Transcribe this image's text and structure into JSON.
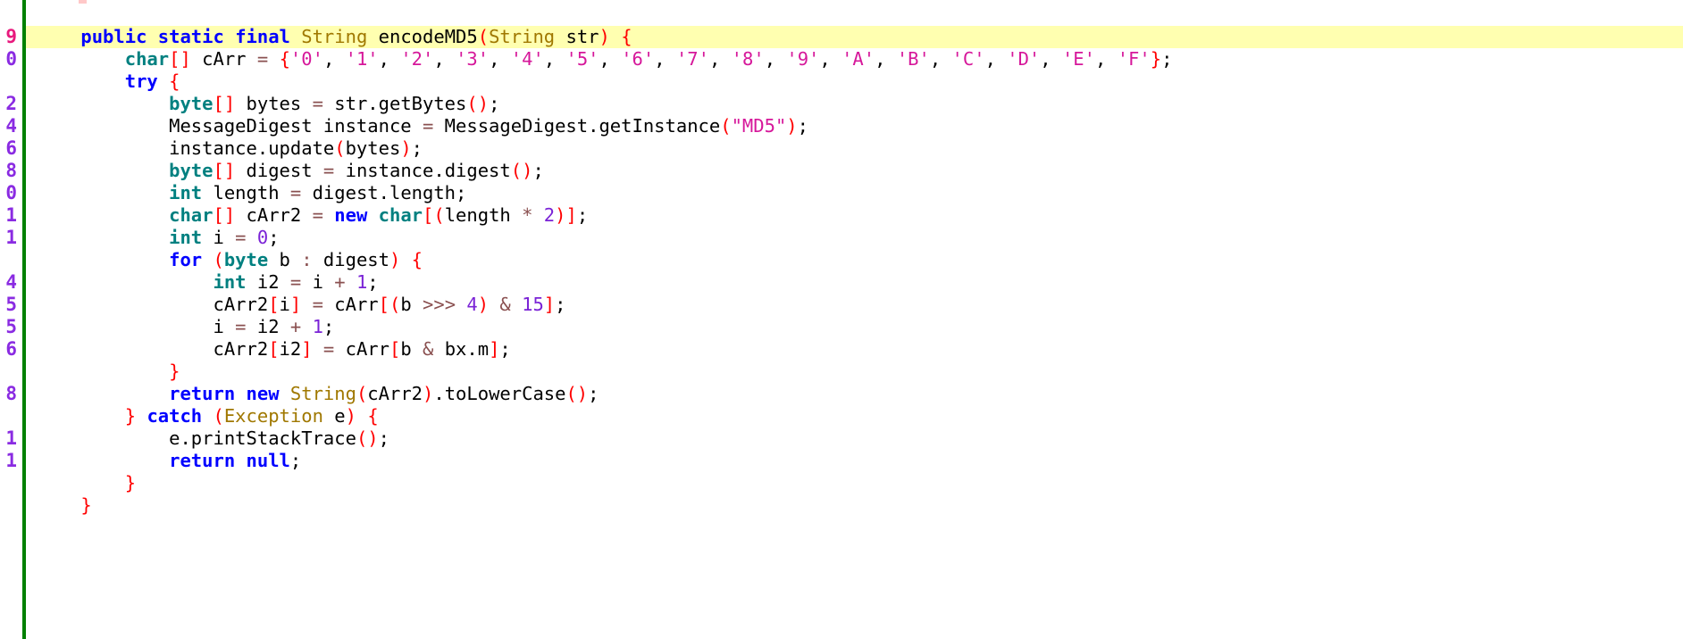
{
  "editor": {
    "language": "Java",
    "current_line_index": 0,
    "gutter_rule_color": "#008000",
    "highlight_color": "#ffffb0",
    "background_color": "#ffffff",
    "line_number_color": "#8a2be2",
    "current_line_number_color": "#e8197d",
    "font_size_px": 20.5,
    "line_height_px": 25
  },
  "palette": {
    "keyword": "#0000ff",
    "type": "#008080",
    "class": "#a07800",
    "punctuation": "#ff0000",
    "number": "#7a22d6",
    "string": "#d6179a",
    "operator": "#8a5050",
    "identifier": "#000000"
  },
  "lines": [
    {
      "number": "9",
      "current": true,
      "indent": 4,
      "tokens": [
        {
          "t": "public",
          "c": "kw"
        },
        {
          "t": " ",
          "c": "id"
        },
        {
          "t": "static",
          "c": "kw"
        },
        {
          "t": " ",
          "c": "id"
        },
        {
          "t": "final",
          "c": "kw"
        },
        {
          "t": " ",
          "c": "id"
        },
        {
          "t": "String",
          "c": "cls"
        },
        {
          "t": " ",
          "c": "id"
        },
        {
          "t": "encodeMD5",
          "c": "id"
        },
        {
          "t": "(",
          "c": "pn"
        },
        {
          "t": "String",
          "c": "cls"
        },
        {
          "t": " ",
          "c": "id"
        },
        {
          "t": "str",
          "c": "id"
        },
        {
          "t": ")",
          "c": "pn"
        },
        {
          "t": " ",
          "c": "id"
        },
        {
          "t": "{",
          "c": "pn"
        }
      ]
    },
    {
      "number": "0",
      "current": false,
      "indent": 8,
      "tokens": [
        {
          "t": "char",
          "c": "type"
        },
        {
          "t": "[]",
          "c": "pn"
        },
        {
          "t": " ",
          "c": "id"
        },
        {
          "t": "cArr",
          "c": "id"
        },
        {
          "t": " ",
          "c": "id"
        },
        {
          "t": "=",
          "c": "op"
        },
        {
          "t": " ",
          "c": "id"
        },
        {
          "t": "{",
          "c": "pn"
        },
        {
          "t": "'0'",
          "c": "str"
        },
        {
          "t": ", ",
          "c": "id"
        },
        {
          "t": "'1'",
          "c": "str"
        },
        {
          "t": ", ",
          "c": "id"
        },
        {
          "t": "'2'",
          "c": "str"
        },
        {
          "t": ", ",
          "c": "id"
        },
        {
          "t": "'3'",
          "c": "str"
        },
        {
          "t": ", ",
          "c": "id"
        },
        {
          "t": "'4'",
          "c": "str"
        },
        {
          "t": ", ",
          "c": "id"
        },
        {
          "t": "'5'",
          "c": "str"
        },
        {
          "t": ", ",
          "c": "id"
        },
        {
          "t": "'6'",
          "c": "str"
        },
        {
          "t": ", ",
          "c": "id"
        },
        {
          "t": "'7'",
          "c": "str"
        },
        {
          "t": ", ",
          "c": "id"
        },
        {
          "t": "'8'",
          "c": "str"
        },
        {
          "t": ", ",
          "c": "id"
        },
        {
          "t": "'9'",
          "c": "str"
        },
        {
          "t": ", ",
          "c": "id"
        },
        {
          "t": "'A'",
          "c": "str"
        },
        {
          "t": ", ",
          "c": "id"
        },
        {
          "t": "'B'",
          "c": "str"
        },
        {
          "t": ", ",
          "c": "id"
        },
        {
          "t": "'C'",
          "c": "str"
        },
        {
          "t": ", ",
          "c": "id"
        },
        {
          "t": "'D'",
          "c": "str"
        },
        {
          "t": ", ",
          "c": "id"
        },
        {
          "t": "'E'",
          "c": "str"
        },
        {
          "t": ", ",
          "c": "id"
        },
        {
          "t": "'F'",
          "c": "str"
        },
        {
          "t": "}",
          "c": "pn"
        },
        {
          "t": ";",
          "c": "id"
        }
      ]
    },
    {
      "number": "",
      "current": false,
      "indent": 8,
      "tokens": [
        {
          "t": "try",
          "c": "kw"
        },
        {
          "t": " ",
          "c": "id"
        },
        {
          "t": "{",
          "c": "pn"
        }
      ]
    },
    {
      "number": "2",
      "current": false,
      "indent": 12,
      "tokens": [
        {
          "t": "byte",
          "c": "type"
        },
        {
          "t": "[]",
          "c": "pn"
        },
        {
          "t": " ",
          "c": "id"
        },
        {
          "t": "bytes",
          "c": "id"
        },
        {
          "t": " ",
          "c": "id"
        },
        {
          "t": "=",
          "c": "op"
        },
        {
          "t": " ",
          "c": "id"
        },
        {
          "t": "str.getBytes",
          "c": "id"
        },
        {
          "t": "()",
          "c": "pn"
        },
        {
          "t": ";",
          "c": "id"
        }
      ]
    },
    {
      "number": "4",
      "current": false,
      "indent": 12,
      "tokens": [
        {
          "t": "MessageDigest instance",
          "c": "id"
        },
        {
          "t": " ",
          "c": "id"
        },
        {
          "t": "=",
          "c": "op"
        },
        {
          "t": " ",
          "c": "id"
        },
        {
          "t": "MessageDigest.getInstance",
          "c": "id"
        },
        {
          "t": "(",
          "c": "pn"
        },
        {
          "t": "\"MD5\"",
          "c": "str"
        },
        {
          "t": ")",
          "c": "pn"
        },
        {
          "t": ";",
          "c": "id"
        }
      ]
    },
    {
      "number": "6",
      "current": false,
      "indent": 12,
      "tokens": [
        {
          "t": "instance.update",
          "c": "id"
        },
        {
          "t": "(",
          "c": "pn"
        },
        {
          "t": "bytes",
          "c": "id"
        },
        {
          "t": ")",
          "c": "pn"
        },
        {
          "t": ";",
          "c": "id"
        }
      ]
    },
    {
      "number": "8",
      "current": false,
      "indent": 12,
      "tokens": [
        {
          "t": "byte",
          "c": "type"
        },
        {
          "t": "[]",
          "c": "pn"
        },
        {
          "t": " ",
          "c": "id"
        },
        {
          "t": "digest",
          "c": "id"
        },
        {
          "t": " ",
          "c": "id"
        },
        {
          "t": "=",
          "c": "op"
        },
        {
          "t": " ",
          "c": "id"
        },
        {
          "t": "instance.digest",
          "c": "id"
        },
        {
          "t": "()",
          "c": "pn"
        },
        {
          "t": ";",
          "c": "id"
        }
      ]
    },
    {
      "number": "0",
      "current": false,
      "indent": 12,
      "tokens": [
        {
          "t": "int",
          "c": "type"
        },
        {
          "t": " ",
          "c": "id"
        },
        {
          "t": "length",
          "c": "id"
        },
        {
          "t": " ",
          "c": "id"
        },
        {
          "t": "=",
          "c": "op"
        },
        {
          "t": " ",
          "c": "id"
        },
        {
          "t": "digest.length",
          "c": "id"
        },
        {
          "t": ";",
          "c": "id"
        }
      ]
    },
    {
      "number": "1",
      "current": false,
      "indent": 12,
      "tokens": [
        {
          "t": "char",
          "c": "type"
        },
        {
          "t": "[]",
          "c": "pn"
        },
        {
          "t": " ",
          "c": "id"
        },
        {
          "t": "cArr2",
          "c": "id"
        },
        {
          "t": " ",
          "c": "id"
        },
        {
          "t": "=",
          "c": "op"
        },
        {
          "t": " ",
          "c": "id"
        },
        {
          "t": "new",
          "c": "kw"
        },
        {
          "t": " ",
          "c": "id"
        },
        {
          "t": "char",
          "c": "type"
        },
        {
          "t": "[(",
          "c": "pn"
        },
        {
          "t": "length",
          "c": "id"
        },
        {
          "t": " ",
          "c": "id"
        },
        {
          "t": "*",
          "c": "op"
        },
        {
          "t": " ",
          "c": "id"
        },
        {
          "t": "2",
          "c": "num"
        },
        {
          "t": ")]",
          "c": "pn"
        },
        {
          "t": ";",
          "c": "id"
        }
      ]
    },
    {
      "number": "1",
      "current": false,
      "indent": 12,
      "tokens": [
        {
          "t": "int",
          "c": "type"
        },
        {
          "t": " ",
          "c": "id"
        },
        {
          "t": "i",
          "c": "id"
        },
        {
          "t": " ",
          "c": "id"
        },
        {
          "t": "=",
          "c": "op"
        },
        {
          "t": " ",
          "c": "id"
        },
        {
          "t": "0",
          "c": "num"
        },
        {
          "t": ";",
          "c": "id"
        }
      ]
    },
    {
      "number": "",
      "current": false,
      "indent": 12,
      "tokens": [
        {
          "t": "for",
          "c": "kw"
        },
        {
          "t": " ",
          "c": "id"
        },
        {
          "t": "(",
          "c": "pn"
        },
        {
          "t": "byte",
          "c": "type"
        },
        {
          "t": " ",
          "c": "id"
        },
        {
          "t": "b",
          "c": "id"
        },
        {
          "t": " ",
          "c": "id"
        },
        {
          "t": ":",
          "c": "op"
        },
        {
          "t": " ",
          "c": "id"
        },
        {
          "t": "digest",
          "c": "id"
        },
        {
          "t": ")",
          "c": "pn"
        },
        {
          "t": " ",
          "c": "id"
        },
        {
          "t": "{",
          "c": "pn"
        }
      ]
    },
    {
      "number": "4",
      "current": false,
      "indent": 16,
      "tokens": [
        {
          "t": "int",
          "c": "type"
        },
        {
          "t": " ",
          "c": "id"
        },
        {
          "t": "i2",
          "c": "id"
        },
        {
          "t": " ",
          "c": "id"
        },
        {
          "t": "=",
          "c": "op"
        },
        {
          "t": " ",
          "c": "id"
        },
        {
          "t": "i",
          "c": "id"
        },
        {
          "t": " ",
          "c": "id"
        },
        {
          "t": "+",
          "c": "op"
        },
        {
          "t": " ",
          "c": "id"
        },
        {
          "t": "1",
          "c": "num"
        },
        {
          "t": ";",
          "c": "id"
        }
      ]
    },
    {
      "number": "5",
      "current": false,
      "indent": 16,
      "tokens": [
        {
          "t": "cArr2",
          "c": "id"
        },
        {
          "t": "[",
          "c": "pn"
        },
        {
          "t": "i",
          "c": "id"
        },
        {
          "t": "]",
          "c": "pn"
        },
        {
          "t": " ",
          "c": "id"
        },
        {
          "t": "=",
          "c": "op"
        },
        {
          "t": " ",
          "c": "id"
        },
        {
          "t": "cArr",
          "c": "id"
        },
        {
          "t": "[(",
          "c": "pn"
        },
        {
          "t": "b",
          "c": "id"
        },
        {
          "t": " ",
          "c": "id"
        },
        {
          "t": ">>>",
          "c": "op"
        },
        {
          "t": " ",
          "c": "id"
        },
        {
          "t": "4",
          "c": "num"
        },
        {
          "t": ")",
          "c": "pn"
        },
        {
          "t": " ",
          "c": "id"
        },
        {
          "t": "&",
          "c": "op"
        },
        {
          "t": " ",
          "c": "id"
        },
        {
          "t": "15",
          "c": "num"
        },
        {
          "t": "]",
          "c": "pn"
        },
        {
          "t": ";",
          "c": "id"
        }
      ]
    },
    {
      "number": "5",
      "current": false,
      "indent": 16,
      "tokens": [
        {
          "t": "i",
          "c": "id"
        },
        {
          "t": " ",
          "c": "id"
        },
        {
          "t": "=",
          "c": "op"
        },
        {
          "t": " ",
          "c": "id"
        },
        {
          "t": "i2",
          "c": "id"
        },
        {
          "t": " ",
          "c": "id"
        },
        {
          "t": "+",
          "c": "op"
        },
        {
          "t": " ",
          "c": "id"
        },
        {
          "t": "1",
          "c": "num"
        },
        {
          "t": ";",
          "c": "id"
        }
      ]
    },
    {
      "number": "6",
      "current": false,
      "indent": 16,
      "tokens": [
        {
          "t": "cArr2",
          "c": "id"
        },
        {
          "t": "[",
          "c": "pn"
        },
        {
          "t": "i2",
          "c": "id"
        },
        {
          "t": "]",
          "c": "pn"
        },
        {
          "t": " ",
          "c": "id"
        },
        {
          "t": "=",
          "c": "op"
        },
        {
          "t": " ",
          "c": "id"
        },
        {
          "t": "cArr",
          "c": "id"
        },
        {
          "t": "[",
          "c": "pn"
        },
        {
          "t": "b",
          "c": "id"
        },
        {
          "t": " ",
          "c": "id"
        },
        {
          "t": "&",
          "c": "op"
        },
        {
          "t": " ",
          "c": "id"
        },
        {
          "t": "bx.m",
          "c": "id"
        },
        {
          "t": "]",
          "c": "pn"
        },
        {
          "t": ";",
          "c": "id"
        }
      ]
    },
    {
      "number": "",
      "current": false,
      "indent": 12,
      "tokens": [
        {
          "t": "}",
          "c": "pn"
        }
      ]
    },
    {
      "number": "8",
      "current": false,
      "indent": 12,
      "tokens": [
        {
          "t": "return",
          "c": "kw"
        },
        {
          "t": " ",
          "c": "id"
        },
        {
          "t": "new",
          "c": "kw"
        },
        {
          "t": " ",
          "c": "id"
        },
        {
          "t": "String",
          "c": "cls"
        },
        {
          "t": "(",
          "c": "pn"
        },
        {
          "t": "cArr2",
          "c": "id"
        },
        {
          "t": ")",
          "c": "pn"
        },
        {
          "t": ".toLowerCase",
          "c": "id"
        },
        {
          "t": "()",
          "c": "pn"
        },
        {
          "t": ";",
          "c": "id"
        }
      ]
    },
    {
      "number": "",
      "current": false,
      "indent": 8,
      "tokens": [
        {
          "t": "}",
          "c": "pn"
        },
        {
          "t": " ",
          "c": "id"
        },
        {
          "t": "catch",
          "c": "kw"
        },
        {
          "t": " ",
          "c": "id"
        },
        {
          "t": "(",
          "c": "pn"
        },
        {
          "t": "Exception",
          "c": "cls"
        },
        {
          "t": " ",
          "c": "id"
        },
        {
          "t": "e",
          "c": "id"
        },
        {
          "t": ")",
          "c": "pn"
        },
        {
          "t": " ",
          "c": "id"
        },
        {
          "t": "{",
          "c": "pn"
        }
      ]
    },
    {
      "number": "1",
      "current": false,
      "indent": 12,
      "tokens": [
        {
          "t": "e.printStackTrace",
          "c": "id"
        },
        {
          "t": "()",
          "c": "pn"
        },
        {
          "t": ";",
          "c": "id"
        }
      ]
    },
    {
      "number": "1",
      "current": false,
      "indent": 12,
      "tokens": [
        {
          "t": "return",
          "c": "kw"
        },
        {
          "t": " ",
          "c": "id"
        },
        {
          "t": "null",
          "c": "kw"
        },
        {
          "t": ";",
          "c": "id"
        }
      ]
    },
    {
      "number": "",
      "current": false,
      "indent": 8,
      "tokens": [
        {
          "t": "}",
          "c": "pn"
        }
      ]
    },
    {
      "number": "",
      "current": false,
      "indent": 4,
      "tokens": [
        {
          "t": "}",
          "c": "pn"
        }
      ]
    }
  ]
}
